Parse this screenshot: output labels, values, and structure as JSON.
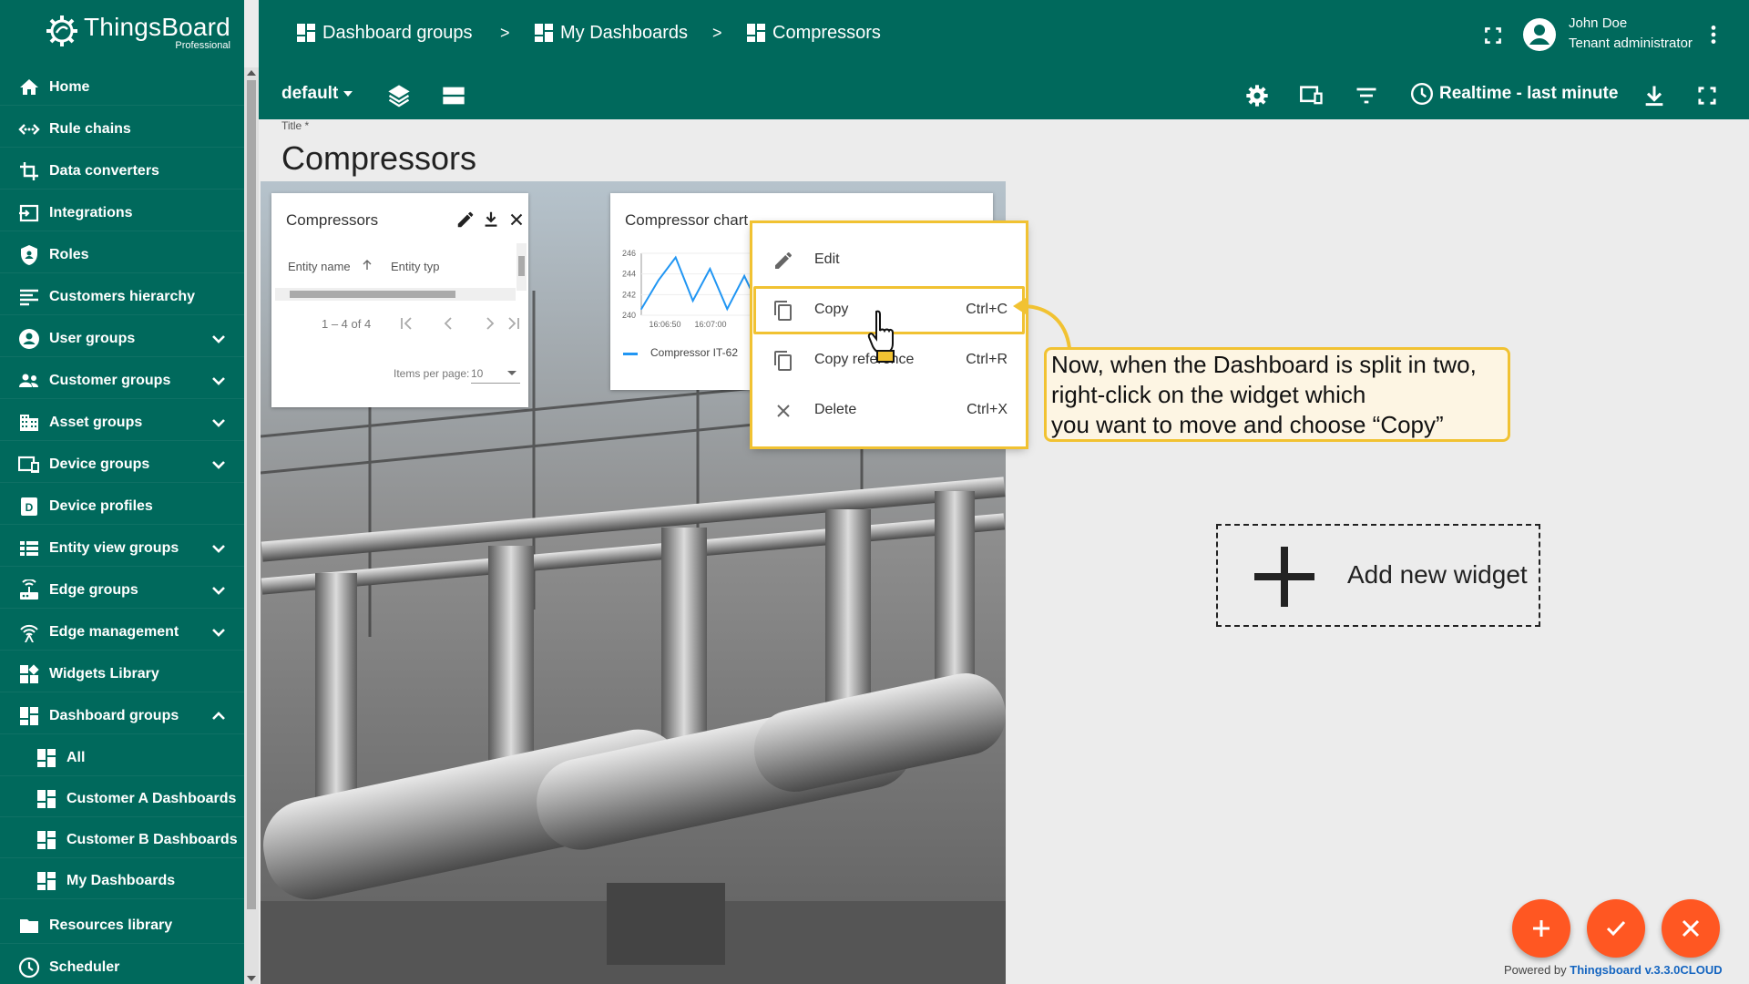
{
  "app": {
    "brand": "ThingsBoard",
    "edition": "Professional"
  },
  "colors": {
    "primary": "#00695c",
    "accent": "#ff5722",
    "highlight": "#f1c232",
    "note_bg": "#fdf5e3",
    "chart_line": "#2196f3"
  },
  "sidebar": {
    "items": [
      {
        "label": "Home",
        "icon": "home-icon"
      },
      {
        "label": "Rule chains",
        "icon": "rule-chain-icon"
      },
      {
        "label": "Data converters",
        "icon": "converter-icon"
      },
      {
        "label": "Integrations",
        "icon": "integration-icon"
      },
      {
        "label": "Roles",
        "icon": "shield-icon"
      },
      {
        "label": "Customers hierarchy",
        "icon": "hierarchy-icon"
      },
      {
        "label": "User groups",
        "icon": "user-icon",
        "expandable": true
      },
      {
        "label": "Customer groups",
        "icon": "group-icon",
        "expandable": true
      },
      {
        "label": "Asset groups",
        "icon": "building-icon",
        "expandable": true
      },
      {
        "label": "Device groups",
        "icon": "devices-icon",
        "expandable": true
      },
      {
        "label": "Device profiles",
        "icon": "device-profile-icon"
      },
      {
        "label": "Entity view groups",
        "icon": "view-list-icon",
        "expandable": true
      },
      {
        "label": "Edge groups",
        "icon": "router-icon",
        "expandable": true
      },
      {
        "label": "Edge management",
        "icon": "wifi-tower-icon",
        "expandable": true
      },
      {
        "label": "Widgets Library",
        "icon": "widgets-icon"
      },
      {
        "label": "Dashboard groups",
        "icon": "dashboard-icon",
        "expanded": true
      },
      {
        "label": "All",
        "icon": "dashboard-icon",
        "sub": true
      },
      {
        "label": "Customer A Dashboards",
        "icon": "dashboard-icon",
        "sub": true
      },
      {
        "label": "Customer B Dashboards",
        "icon": "dashboard-icon",
        "sub": true
      },
      {
        "label": "My Dashboards",
        "icon": "dashboard-icon",
        "sub": true
      },
      {
        "label": "Resources library",
        "icon": "folder-icon"
      },
      {
        "label": "Scheduler",
        "icon": "clock-icon"
      }
    ]
  },
  "breadcrumb": [
    "Dashboard groups",
    "My Dashboards",
    "Compressors"
  ],
  "breadcrumb_sep": ">",
  "user": {
    "name": "John Doe",
    "role": "Tenant administrator"
  },
  "toolbar": {
    "state": "default",
    "timewindow": "Realtime - last minute"
  },
  "dashboard": {
    "title_label": "Title *",
    "title": "Compressors"
  },
  "entities_widget": {
    "title": "Compressors",
    "columns": [
      "Entity name",
      "Entity typ"
    ],
    "paginator": {
      "range": "1 – 4 of 4",
      "items_per_page_label": "Items per page:",
      "items_per_page": "10"
    }
  },
  "chart_widget": {
    "title": "Compressor chart",
    "legend": "Compressor IT-62"
  },
  "chart_data": {
    "type": "line",
    "x_ticks": [
      "16:06:50",
      "16:07:00"
    ],
    "y_ticks": [
      246,
      244,
      242,
      240
    ],
    "ylim": [
      240,
      246
    ],
    "series": [
      {
        "name": "Compressor IT-62",
        "values": [
          240.6,
          243.4,
          245.6,
          241.4,
          244.5,
          240.6,
          243.8,
          240.3
        ]
      }
    ]
  },
  "context_menu": {
    "items": [
      {
        "label": "Edit",
        "shortcut": "",
        "icon": "pencil-icon"
      },
      {
        "label": "Copy",
        "shortcut": "Ctrl+C",
        "icon": "copy-icon"
      },
      {
        "label": "Copy reference",
        "shortcut": "Ctrl+R",
        "icon": "copy-reference-icon"
      },
      {
        "label": "Delete",
        "shortcut": "Ctrl+X",
        "icon": "close-icon"
      }
    ]
  },
  "note": {
    "lines": [
      "Now, when the Dashboard is split in two,",
      "right-click on the widget which",
      "you want to move and choose “Copy”"
    ]
  },
  "add_widget": {
    "label": "Add new widget"
  },
  "footer": {
    "powered_prefix": "Powered by",
    "powered_link": "Thingsboard v.3.3.0CLOUD"
  }
}
